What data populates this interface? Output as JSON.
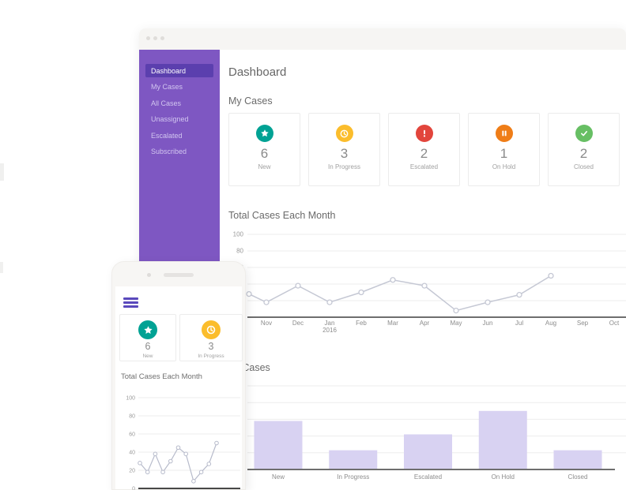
{
  "sidebar": {
    "items": [
      {
        "label": "Dashboard",
        "active": true
      },
      {
        "label": "My Cases",
        "active": false
      },
      {
        "label": "All Cases",
        "active": false
      },
      {
        "label": "Unassigned",
        "active": false
      },
      {
        "label": "Escalated",
        "active": false
      },
      {
        "label": "Subscribed",
        "active": false
      }
    ]
  },
  "main": {
    "title": "Dashboard",
    "my_cases_heading": "My Cases",
    "line_chart_heading": "Total Cases Each Month",
    "bar_chart_heading": "All Cases",
    "stat_cards": [
      {
        "icon": "star-icon",
        "color": "#00A294",
        "value": "6",
        "label": "New"
      },
      {
        "icon": "clock-icon",
        "color": "#FBBD2C",
        "value": "3",
        "label": "In Progress"
      },
      {
        "icon": "exclamation-icon",
        "color": "#E2453C",
        "value": "2",
        "label": "Escalated"
      },
      {
        "icon": "pause-icon",
        "color": "#EF7D17",
        "value": "1",
        "label": "On Hold"
      },
      {
        "icon": "check-icon",
        "color": "#67BF64",
        "value": "2",
        "label": "Closed"
      }
    ]
  },
  "phone": {
    "chart_heading": "Total Cases Each Month",
    "stat_cards": [
      {
        "icon": "star-icon",
        "color": "#00A294",
        "value": "6",
        "label": "New"
      },
      {
        "icon": "clock-icon",
        "color": "#FBBD2C",
        "value": "3",
        "label": "In Progress"
      }
    ]
  },
  "chart_data": [
    {
      "id": "total-cases-line",
      "type": "line",
      "title": "Total Cases Each Month",
      "x_tick_labels": [
        "Nov",
        "Dec",
        "Jan",
        "Feb",
        "Mar",
        "Apr",
        "May",
        "Jun",
        "Jul",
        "Aug",
        "Sep",
        "Oct"
      ],
      "x_sub_label": {
        "index": 2,
        "text": "2016"
      },
      "values": [
        28,
        18,
        38,
        18,
        30,
        45,
        38,
        8,
        18,
        27,
        50
      ],
      "first_point_on_axis": true,
      "ylim": [
        0,
        100
      ],
      "yticks": [
        0,
        20,
        40,
        60,
        80,
        100
      ],
      "grid": true,
      "legend": "none",
      "line_color": "#C5C8D4"
    },
    {
      "id": "all-cases-bar",
      "type": "bar",
      "title": "All Cases",
      "categories": [
        "New",
        "In Progress",
        "Escalated",
        "On Hold",
        "Closed"
      ],
      "values": [
        58,
        23,
        42,
        70,
        23
      ],
      "ylim": [
        0,
        100
      ],
      "yticks": [
        0,
        20,
        40,
        60,
        80,
        100
      ],
      "grid": true,
      "legend": "none",
      "bar_color": "#D8D2F2"
    },
    {
      "id": "phone-total-cases-line",
      "type": "line",
      "title": "Total Cases Each Month",
      "values": [
        28,
        18,
        38,
        18,
        30,
        45,
        38,
        8,
        18,
        27,
        50
      ],
      "ylim": [
        0,
        100
      ],
      "yticks": [
        0,
        20,
        40,
        60,
        80,
        100
      ],
      "grid": true,
      "legend": "none",
      "line_color": "#B7BBCB"
    }
  ]
}
